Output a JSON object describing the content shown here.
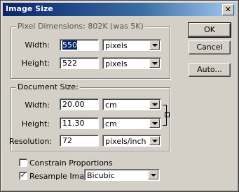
{
  "dialog": {
    "title": "Image Size",
    "close_glyph": "✕"
  },
  "pixel_dimensions": {
    "legend": "Pixel Dimensions: 802K (was 5K)",
    "width_label": "Width:",
    "width_value": "550",
    "width_unit": "pixels",
    "height_label": "Height:",
    "height_value": "522",
    "height_unit": "pixels"
  },
  "document_size": {
    "legend": "Document Size:",
    "width_label": "Width:",
    "width_value": "20.00",
    "width_unit": "cm",
    "height_label": "Height:",
    "height_value": "11.30",
    "height_unit": "cm",
    "resolution_label": "Resolution:",
    "resolution_value": "72",
    "resolution_unit": "pixels/inch"
  },
  "options": {
    "constrain_label": "Constrain Proportions",
    "constrain_checked": false,
    "constrain_mark": "",
    "resample_label": "Resample Image:",
    "resample_checked": true,
    "resample_mark": "✓",
    "resample_method": "Bicubic"
  },
  "buttons": {
    "ok": "OK",
    "cancel": "Cancel",
    "auto": "Auto..."
  }
}
